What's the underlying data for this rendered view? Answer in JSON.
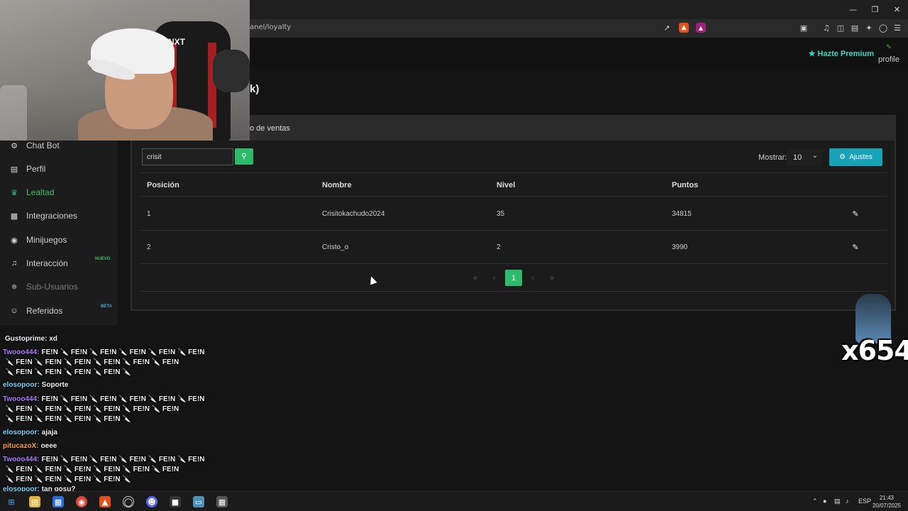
{
  "browser": {
    "url": "anel/loyalty",
    "window_controls": [
      "minimize-icon",
      "restore-icon",
      "close-icon"
    ],
    "address_icons_left": [
      "share-icon",
      "brave-shield-icon",
      "brave-rewards-icon"
    ],
    "address_icons_right": [
      "screenshot-icon",
      "music-icon",
      "sidebar-icon",
      "wallet-icon",
      "leo-icon",
      "vpn-icon",
      "menu-icon"
    ]
  },
  "site_header": {
    "premium_label": "Hazte Premium",
    "profile_label": "profile"
  },
  "page": {
    "title_fragment": "k)",
    "tab_fragment": "o de ventas"
  },
  "sidebar": {
    "items": [
      {
        "label": "Chat Bot",
        "icon": "robot-icon",
        "state": "normal"
      },
      {
        "label": "Perfil",
        "icon": "id-card-icon",
        "state": "normal"
      },
      {
        "label": "Lealtad",
        "icon": "trophy-icon",
        "state": "active"
      },
      {
        "label": "Integraciones",
        "icon": "plug-icon",
        "state": "normal"
      },
      {
        "label": "Minijuegos",
        "icon": "gamepad-icon",
        "state": "normal"
      },
      {
        "label": "Interacción",
        "icon": "music-icon",
        "state": "normal",
        "badge": "NUEVO"
      },
      {
        "label": "Sub-Usuarios",
        "icon": "users-icon",
        "state": "disabled"
      },
      {
        "label": "Referidos",
        "icon": "user-plus-icon",
        "state": "normal",
        "badge": "BETA"
      }
    ]
  },
  "toolbar": {
    "search_value": "crisit",
    "mostrar_label": "Mostrar:",
    "page_size": "10",
    "ajustes_label": "Ajustes"
  },
  "table": {
    "columns": [
      "Posición",
      "Nombre",
      "Nivel",
      "Puntos"
    ],
    "rows": [
      {
        "pos": "1",
        "name": "Crisitokachudo2024",
        "level": "35",
        "points": "34815"
      },
      {
        "pos": "2",
        "name": "Cristo_o",
        "level": "2",
        "points": "3990"
      }
    ]
  },
  "pagination": {
    "first": "«",
    "prev": "‹",
    "current": "1",
    "next": "›",
    "last": "»"
  },
  "chat": {
    "lines": [
      {
        "user": "",
        "text": "Gustoprime: xd"
      },
      {
        "user": "Twooo444:",
        "text": "FE!N 🔪 FE!N 🔪 FE!N 🔪 FE!N 🔪 FE!N 🔪 FE!N"
      },
      {
        "user": "",
        "text": "🔪 FE!N 🔪 FE!N 🔪 FE!N 🔪 FE!N 🔪 FE!N 🔪 FE!N"
      },
      {
        "user": "",
        "text": "🔪 FE!N 🔪 FE!N 🔪 FE!N 🔪 FE!N 🔪"
      },
      {
        "user": "elosopoor:",
        "text": "Soporte"
      },
      {
        "user": "Twooo444:",
        "text": "FE!N 🔪 FE!N 🔪 FE!N 🔪 FE!N 🔪 FE!N 🔪 FE!N"
      },
      {
        "user": "",
        "text": "🔪 FE!N 🔪 FE!N 🔪 FE!N 🔪 FE!N 🔪 FE!N 🔪 FE!N"
      },
      {
        "user": "",
        "text": "🔪 FE!N 🔪 FE!N 🔪 FE!N 🔪 FE!N 🔪"
      },
      {
        "user": "elosopoor:",
        "text": "ajaja"
      },
      {
        "user": "pitucazoX:",
        "text": "oeee"
      },
      {
        "user": "Twooo444:",
        "text": "FE!N 🔪 FE!N 🔪 FE!N 🔪 FE!N 🔪 FE!N 🔪 FE!N"
      },
      {
        "user": "",
        "text": "🔪 FE!N 🔪 FE!N 🔪 FE!N 🔪 FE!N 🔪 FE!N 🔪 FE!N"
      },
      {
        "user": "",
        "text": "🔪 FE!N 🔪 FE!N 🔪 FE!N 🔪 FE!N 🔪"
      },
      {
        "user": "elosopoor:",
        "text": "tan gosu?"
      }
    ]
  },
  "sticker": {
    "text": "x654"
  },
  "taskbar": {
    "lang": "ESP",
    "time": "21:43",
    "date": "20/07/2025"
  },
  "colors": {
    "accent_green": "#2dbb6b",
    "accent_teal": "#17a2b8",
    "premium": "#38d9c7"
  }
}
